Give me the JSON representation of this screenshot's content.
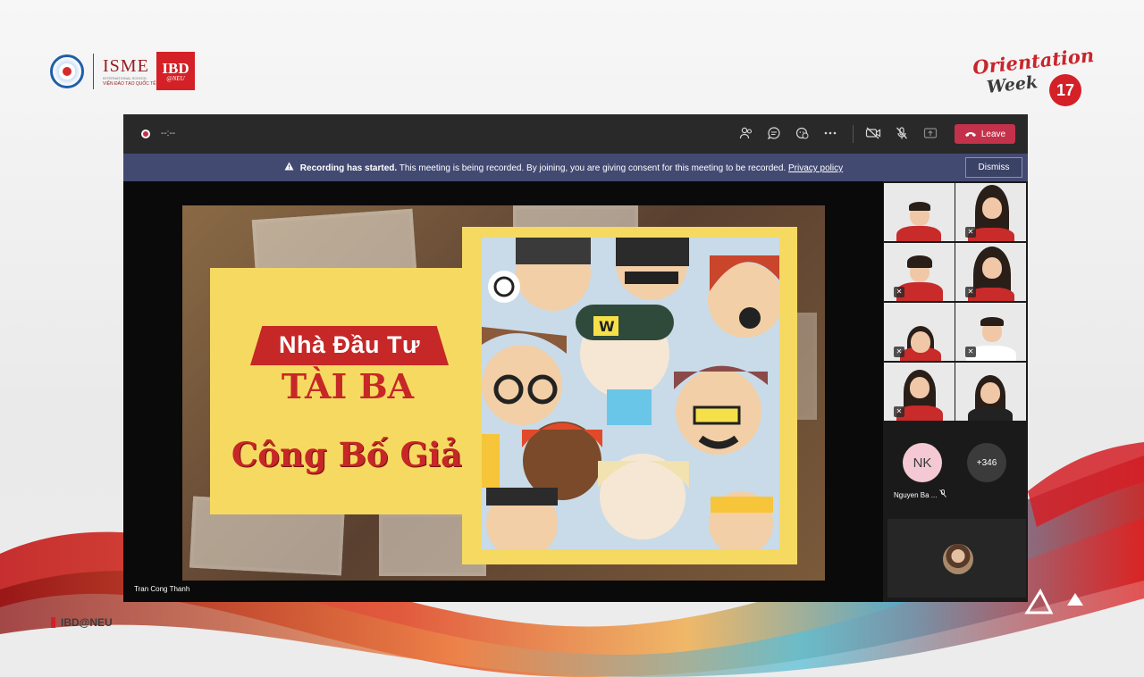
{
  "branding": {
    "isme_logo": "ISME",
    "isme_sub": "INTERNATIONAL SCHOOL",
    "isme_sub2": "VIỆN ĐÀO TẠO QUỐC TẾ",
    "ibd_logo_line1": "IBD",
    "ibd_logo_line2": "@NEU",
    "event_logo_line1": "Orientation",
    "event_logo_line2": "Week",
    "event_logo_number": "17",
    "footer_text": "IBD@NEU"
  },
  "meeting": {
    "timer": "--:--",
    "leave_label": "Leave",
    "banner": {
      "bold": "Recording has started.",
      "message": "This meeting is being recorded. By joining, you are giving consent for this meeting to be recorded.",
      "link": "Privacy policy",
      "dismiss_label": "Dismiss"
    },
    "presenter_name": "Tran Cong Thanh",
    "shared_slide": {
      "title_line1": "Nhà Đầu Tư",
      "title_line2": "TÀI BA",
      "title_line3": "Công Bố Giải"
    },
    "gallery": {
      "avatar_initials": "NK",
      "avatar_name": "Nguyen Ba ...",
      "overflow_count": "+346"
    }
  },
  "icons": [
    "record-icon",
    "participants-icon",
    "chat-icon",
    "reactions-icon",
    "more-icon",
    "camera-off-icon",
    "mic-off-icon",
    "share-tray-icon",
    "phone-icon",
    "warning-icon"
  ],
  "colors": {
    "leave": "#c4314b",
    "banner": "#424a72",
    "brand_red": "#d42027",
    "slide_yellow": "#f6d961"
  }
}
